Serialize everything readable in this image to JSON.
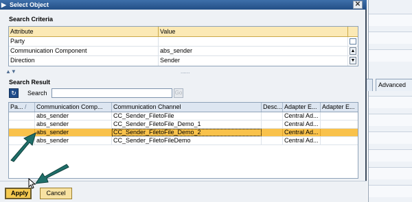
{
  "dialog": {
    "title": "Select Object",
    "close_glyph": "✕",
    "title_icon": "sap-icon"
  },
  "background_app": {
    "tabs": [
      "s",
      "Advanced"
    ]
  },
  "criteria": {
    "heading": "Search Criteria",
    "columns": [
      "Attribute",
      "Value"
    ],
    "rows": [
      {
        "attribute": "Party",
        "value": ""
      },
      {
        "attribute": "Communication Component",
        "value": "abs_sender"
      },
      {
        "attribute": "Direction",
        "value": "Sender"
      }
    ]
  },
  "splitter": {
    "arrows": "▲▼",
    "dots": "......"
  },
  "result": {
    "heading": "Search Result",
    "search_label": "Search",
    "search_value": "",
    "go_label": "Go",
    "columns": [
      "Pa...",
      "Communication Comp...",
      "Communication Channel",
      "Desc...",
      "Adapter E...",
      "Adapter E..."
    ],
    "sort_indicator": "/",
    "rows": [
      {
        "component": "abs_sender",
        "channel": "CC_Sender_FiletoFile",
        "desc": "",
        "adapter1": "Central Ad...",
        "adapter2": "",
        "selected": false
      },
      {
        "component": "abs_sender",
        "channel": "CC_Sender_FiletoFile_Demo_1",
        "desc": "",
        "adapter1": "Central Ad...",
        "adapter2": "",
        "selected": false
      },
      {
        "component": "abs_sender",
        "channel": "CC_Sender_FiletoFile_Demo_2",
        "desc": "",
        "adapter1": "Central Ad...",
        "adapter2": "",
        "selected": true
      },
      {
        "component": "abs_sender",
        "channel": "CC_Sender_FiletoFileDemo",
        "desc": "",
        "adapter1": "Central Ad...",
        "adapter2": "",
        "selected": false
      }
    ]
  },
  "footer": {
    "apply_label": "Apply",
    "cancel_label": "Cancel"
  },
  "colors": {
    "selected_row": "#f9c24b",
    "header_criteria": "#fbe9b5",
    "annotation_arrow": "#1f6f6a"
  }
}
